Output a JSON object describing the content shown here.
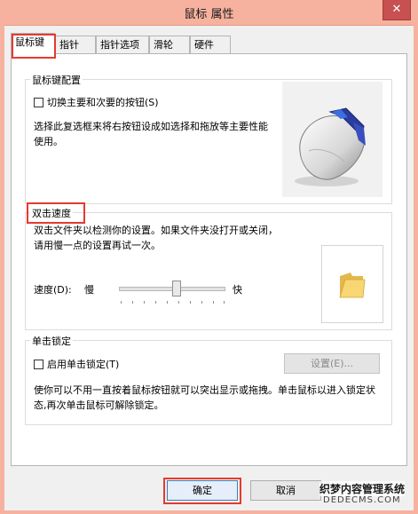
{
  "window": {
    "title": "鼠标 属性",
    "close_glyph": "✕",
    "accent_color": "#f6b29f"
  },
  "tabs": [
    {
      "label": "鼠标键",
      "active": true
    },
    {
      "label": "指针"
    },
    {
      "label": "指针选项"
    },
    {
      "label": "滑轮"
    },
    {
      "label": "硬件"
    }
  ],
  "button_config": {
    "group_title": "鼠标键配置",
    "swap_checkbox_label": "切换主要和次要的按钮(S)",
    "swap_checked": false,
    "description": "选择此复选框来将右按钮设成如选择和拖放等主要性能使用。",
    "mouse_image": "mouse-icon"
  },
  "double_click": {
    "group_title": "双击速度",
    "description": "双击文件夹以检测你的设置。如果文件夹没打开或关闭，请用慢一点的设置再试一次。",
    "speed_label": "速度(D):",
    "slow_label": "慢",
    "fast_label": "快",
    "speed_value": 0.55,
    "test_icon": "folder-icon"
  },
  "click_lock": {
    "group_title": "单击锁定",
    "checkbox_label": "启用单击锁定(T)",
    "checked": false,
    "settings_button": "设置(E)...",
    "description": "使你可以不用一直按着鼠标按钮就可以突出显示或拖拽。单击鼠标以进入锁定状态,再次单击鼠标可解除锁定。"
  },
  "footer": {
    "ok_label": "确定",
    "cancel_label": "取消"
  },
  "watermark": {
    "line1": "织梦内容管理系统",
    "line2": "DEDECMS.COM"
  },
  "highlight_color": "#e53a2f"
}
